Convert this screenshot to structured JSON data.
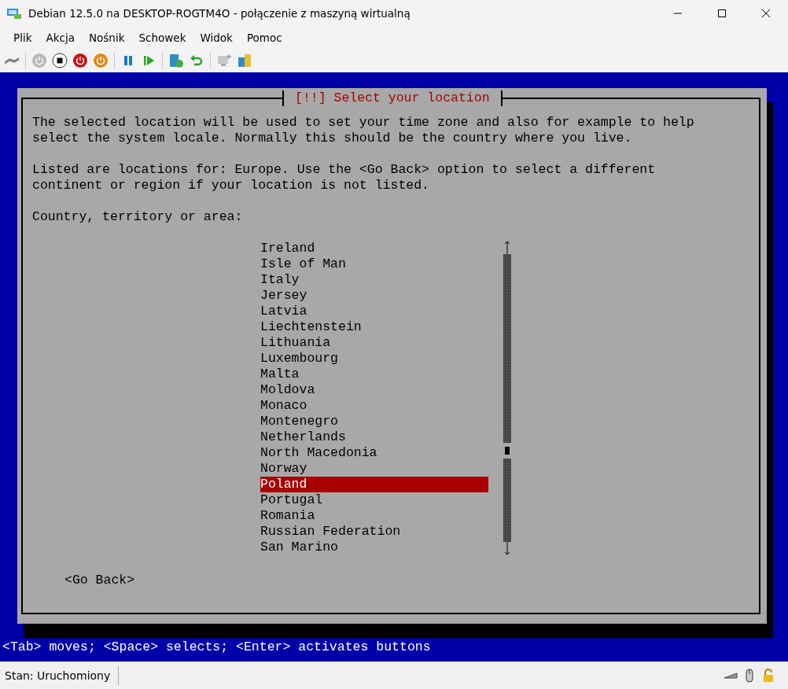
{
  "window": {
    "title": "Debian 12.5.0 na DESKTOP-ROGTM4O - połączenie z maszyną wirtualną"
  },
  "menu": [
    "Plik",
    "Akcja",
    "Nośnik",
    "Schowek",
    "Widok",
    "Pomoc"
  ],
  "dialog": {
    "title": "[!!] Select your location",
    "paragraphs": [
      "The selected location will be used to set your time zone and also for example to help select the system locale. Normally this should be the country where you live.",
      "Listed are locations for: Europe. Use the <Go Back> option to select a different continent or region if your location is not listed.",
      "Country, territory or area:"
    ],
    "items": [
      {
        "label": "Ireland",
        "selected": false
      },
      {
        "label": "Isle of Man",
        "selected": false
      },
      {
        "label": "Italy",
        "selected": false
      },
      {
        "label": "Jersey",
        "selected": false
      },
      {
        "label": "Latvia",
        "selected": false
      },
      {
        "label": "Liechtenstein",
        "selected": false
      },
      {
        "label": "Lithuania",
        "selected": false
      },
      {
        "label": "Luxembourg",
        "selected": false
      },
      {
        "label": "Malta",
        "selected": false
      },
      {
        "label": "Moldova",
        "selected": false
      },
      {
        "label": "Monaco",
        "selected": false
      },
      {
        "label": "Montenegro",
        "selected": false
      },
      {
        "label": "Netherlands",
        "selected": false
      },
      {
        "label": "North Macedonia",
        "selected": false
      },
      {
        "label": "Norway",
        "selected": false
      },
      {
        "label": "Poland",
        "selected": true
      },
      {
        "label": "Portugal",
        "selected": false
      },
      {
        "label": "Romania",
        "selected": false
      },
      {
        "label": "Russian Federation",
        "selected": false
      },
      {
        "label": "San Marino",
        "selected": false
      }
    ],
    "buttons": [
      "<Go Back>"
    ]
  },
  "hint_line": "<Tab> moves; <Space> selects; <Enter> activates buttons",
  "status_bar": {
    "text": "Stan: Uruchomiony"
  }
}
